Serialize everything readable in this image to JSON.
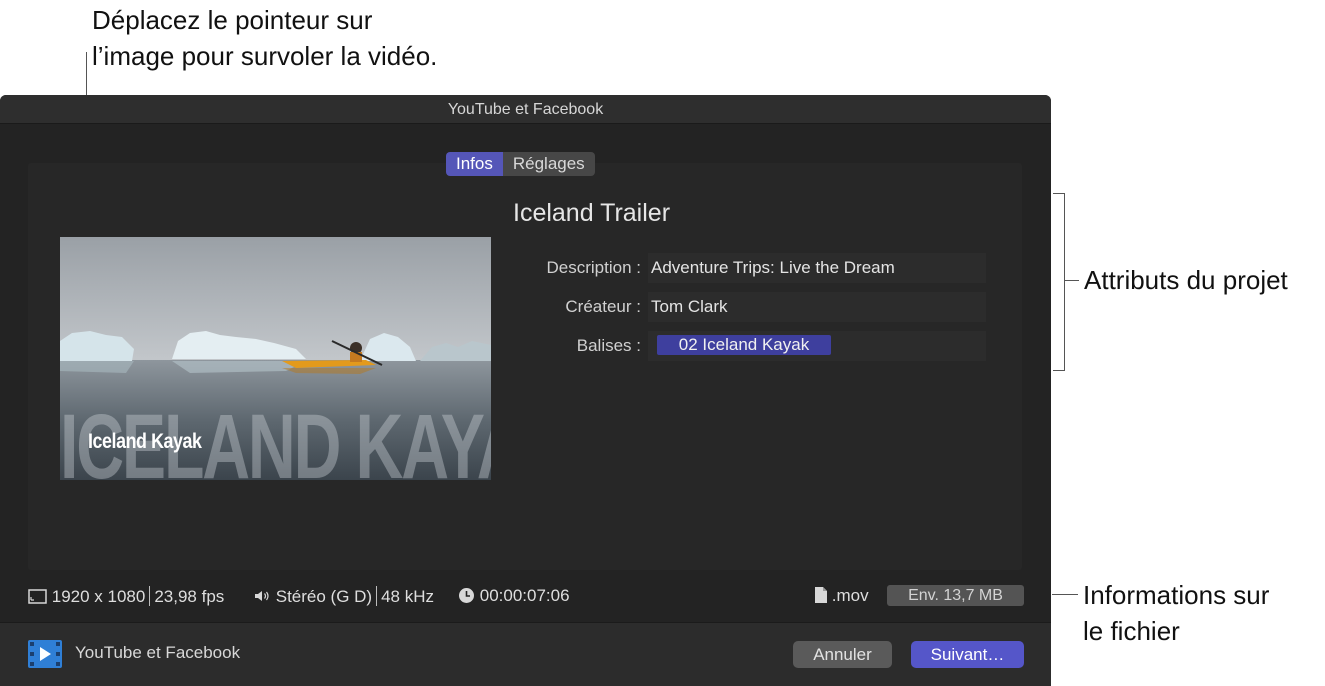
{
  "annotations": {
    "pointer_hint": "Déplacez le pointeur sur\nl’image pour survoler la vidéo.",
    "project_attributes": "Attributs du projet",
    "file_info": "Informations sur\nle fichier"
  },
  "window": {
    "title": "YouTube et Facebook"
  },
  "tabs": [
    {
      "label": "Infos",
      "selected": true
    },
    {
      "label": "Réglages",
      "selected": false
    }
  ],
  "preview": {
    "overlay_title": "Iceland Kayak",
    "background_text": "ICELAND KAYAK"
  },
  "project": {
    "title": "Iceland Trailer",
    "attributes": [
      {
        "label": "Description :",
        "value": "Adventure Trips: Live the Dream"
      },
      {
        "label": "Créateur :",
        "value": "Tom Clark"
      },
      {
        "label": "Balises :",
        "tag": "02 Iceland Kayak"
      }
    ]
  },
  "file_info": {
    "resolution": "1920 x 1080",
    "frame_rate": "23,98 fps",
    "audio_channels": "Stéréo (G D)",
    "sample_rate": "48 kHz",
    "duration": "00:00:07:06",
    "file_type": ".mov",
    "size": "Env. 13,7 MB"
  },
  "footer": {
    "destination": "YouTube et Facebook",
    "cancel_label": "Annuler",
    "next_label": "Suivant…"
  },
  "colors": {
    "accent": "#5556c9",
    "tag": "#3e3f9e",
    "window_bg": "#232323"
  }
}
